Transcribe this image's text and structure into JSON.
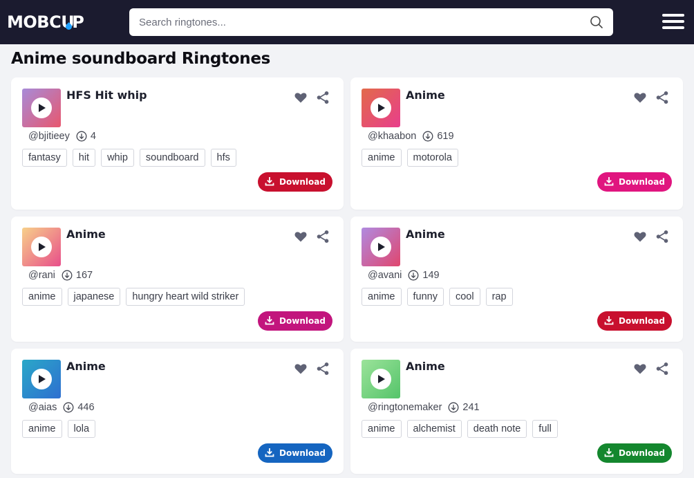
{
  "header": {
    "logo": "MOBCUP",
    "search_placeholder": "Search ringtones..."
  },
  "page_title": "Anime soundboard Ringtones",
  "download_label": "Download",
  "cards": [
    {
      "title": "HFS Hit whip",
      "user": "@bjitieey",
      "downloads": "4",
      "tags": [
        "fantasy",
        "hit",
        "whip",
        "soundboard",
        "hfs"
      ],
      "thumb_gradient": [
        "#a78bd8",
        "#e8576e"
      ],
      "button_color": "#c8102e"
    },
    {
      "title": "Anime",
      "user": "@khaabon",
      "downloads": "619",
      "tags": [
        "anime",
        "motorola"
      ],
      "thumb_gradient": [
        "#e26a4a",
        "#e83e8c"
      ],
      "button_color": "#e0157f"
    },
    {
      "title": "Anime",
      "user": "@rani",
      "downloads": "167",
      "tags": [
        "anime",
        "japanese",
        "hungry heart wild striker"
      ],
      "thumb_gradient": [
        "#f7d08a",
        "#e84e8a"
      ],
      "button_color": "#c2157d"
    },
    {
      "title": "Anime",
      "user": "@avani",
      "downloads": "149",
      "tags": [
        "anime",
        "funny",
        "cool",
        "rap"
      ],
      "thumb_gradient": [
        "#b08ae0",
        "#e0466e"
      ],
      "button_color": "#c8102e"
    },
    {
      "title": "Anime",
      "user": "@aias",
      "downloads": "446",
      "tags": [
        "anime",
        "lola"
      ],
      "thumb_gradient": [
        "#2aa8c8",
        "#2e6fd0"
      ],
      "button_color": "#1565c0"
    },
    {
      "title": "Anime",
      "user": "@ringtonemaker",
      "downloads": "241",
      "tags": [
        "anime",
        "alchemist",
        "death note",
        "full"
      ],
      "thumb_gradient": [
        "#9be39a",
        "#55c46a"
      ],
      "button_color": "#14872e"
    }
  ]
}
